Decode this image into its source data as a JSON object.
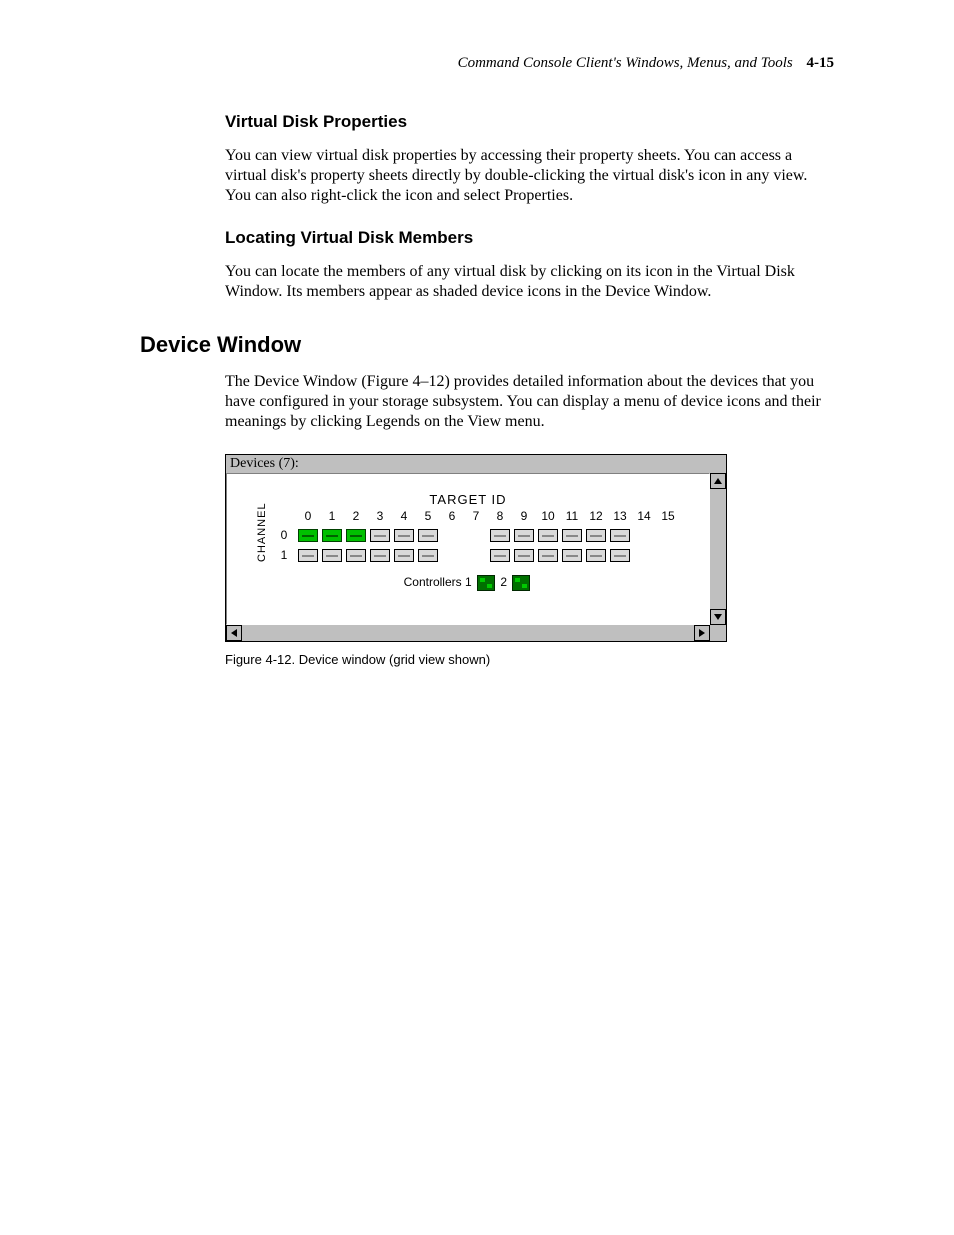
{
  "header": {
    "running_title": "Command Console Client's Windows, Menus, and Tools",
    "page_number": "4-15"
  },
  "sections": {
    "vdp": {
      "title": "Virtual Disk Properties",
      "body": "You can view virtual disk properties by accessing their property sheets. You can access a virtual disk's property sheets directly by double-clicking the virtual disk's icon in any view. You can also right-click the icon and select Properties."
    },
    "lvdm": {
      "title": "Locating Virtual Disk Members",
      "body": "You can locate the members of any virtual disk by clicking on its icon in the Virtual Disk Window. Its members appear as shaded device icons in the Device Window."
    },
    "devwin": {
      "title": "Device Window",
      "body": "The Device Window (Figure 4–12) provides detailed information about the devices that you have configured in your storage subsystem. You can display a menu of device icons and their meanings by clicking Legends on the View menu."
    }
  },
  "figure": {
    "window_title": "Devices (7):",
    "target_label": "TARGET ID",
    "channel_label": "CHANNEL",
    "columns": [
      "0",
      "1",
      "2",
      "3",
      "4",
      "5",
      "6",
      "7",
      "8",
      "9",
      "10",
      "11",
      "12",
      "13",
      "14",
      "15"
    ],
    "rows": [
      {
        "label": "0",
        "cells": [
          "green",
          "green",
          "green",
          "grey",
          "grey",
          "grey",
          "",
          "",
          "grey",
          "grey",
          "grey",
          "grey",
          "grey",
          "grey",
          "",
          ""
        ]
      },
      {
        "label": "1",
        "cells": [
          "grey",
          "grey",
          "grey",
          "grey",
          "grey",
          "grey",
          "",
          "",
          "grey",
          "grey",
          "grey",
          "grey",
          "grey",
          "grey",
          "",
          ""
        ]
      }
    ],
    "controllers_label": "Controllers",
    "controllers": [
      "1",
      "2"
    ],
    "caption": "Figure 4-12.  Device window (grid view shown)"
  }
}
